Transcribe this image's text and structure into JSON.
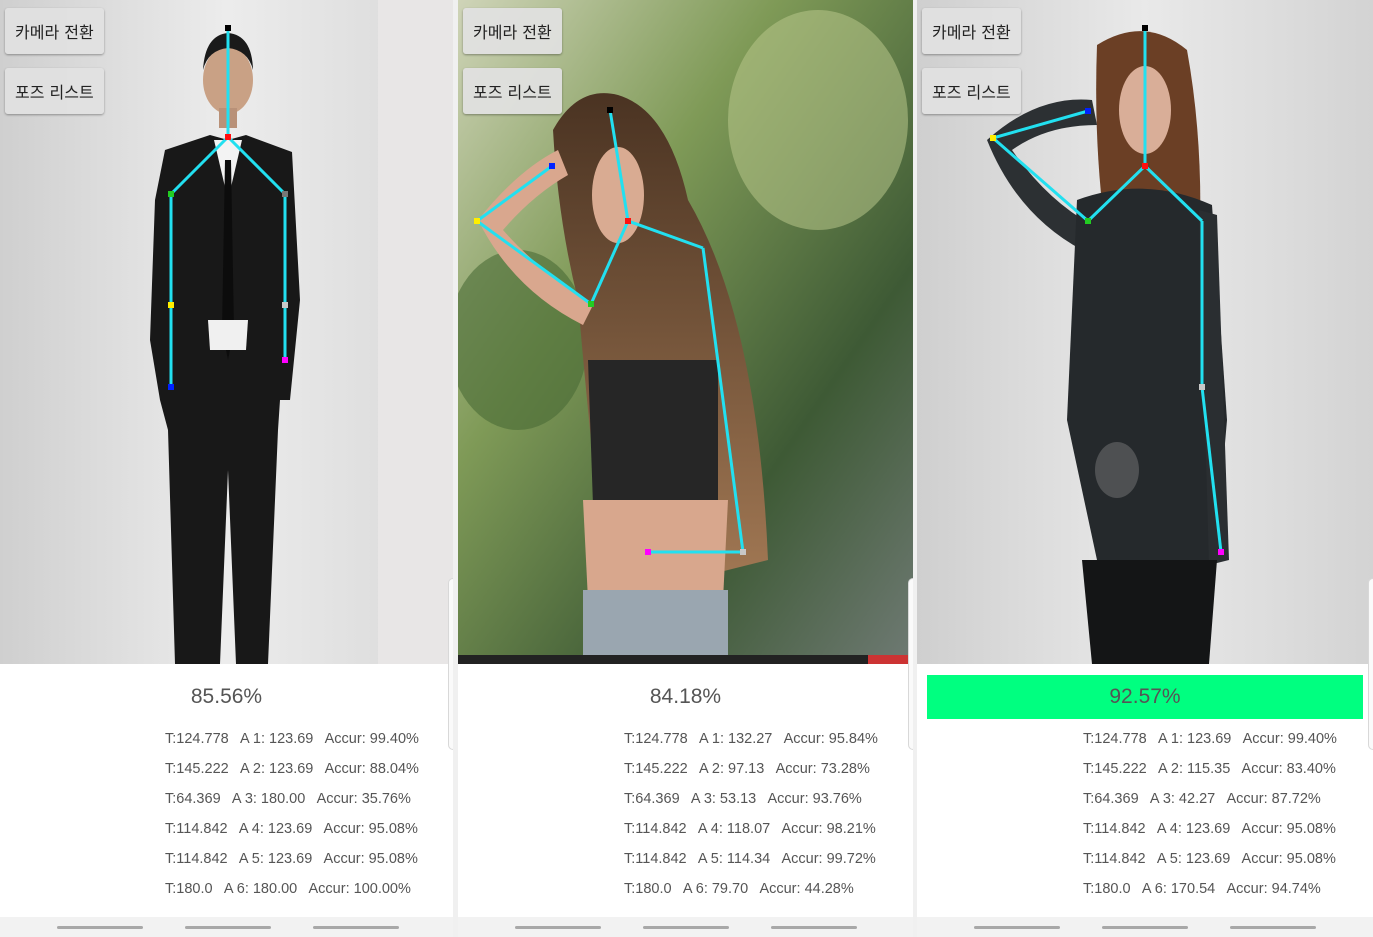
{
  "panels": [
    {
      "buttons": {
        "camera_switch": "카메라 전환",
        "pose_list": "포즈 리스트"
      },
      "score": "85.56%",
      "highlight": false,
      "rows": [
        "T:124.778   A 1: 123.69   Accur: 99.40%",
        "T:145.222   A 2: 123.69   Accur: 88.04%",
        "T:64.369   A 3: 180.00   Accur: 35.76%",
        "T:114.842   A 4: 123.69   Accur: 95.08%",
        "T:114.842   A 5: 123.69   Accur: 95.08%",
        "T:180.0   A 6: 180.00   Accur: 100.00%"
      ]
    },
    {
      "buttons": {
        "camera_switch": "카메라 전환",
        "pose_list": "포즈 리스트"
      },
      "score": "84.18%",
      "highlight": false,
      "rows": [
        "T:124.778   A 1: 132.27   Accur: 95.84%",
        "T:145.222   A 2: 97.13   Accur: 73.28%",
        "T:64.369   A 3: 53.13   Accur: 93.76%",
        "T:114.842   A 4: 118.07   Accur: 98.21%",
        "T:114.842   A 5: 114.34   Accur: 99.72%",
        "T:180.0   A 6: 79.70   Accur: 44.28%"
      ]
    },
    {
      "buttons": {
        "camera_switch": "카메라 전환",
        "pose_list": "포즈 리스트"
      },
      "score": "92.57%",
      "highlight": true,
      "rows": [
        "T:124.778   A 1: 123.69   Accur: 99.40%",
        "T:145.222   A 2: 115.35   Accur: 83.40%",
        "T:64.369   A 3: 42.27   Accur: 87.72%",
        "T:114.842   A 4: 123.69   Accur: 95.08%",
        "T:114.842   A 5: 123.69   Accur: 95.08%",
        "T:180.0   A 6: 170.54   Accur: 94.74%"
      ]
    }
  ],
  "colors": {
    "skeleton": "#22e0f0",
    "highlight": "#00ff80",
    "text": "#555555"
  }
}
